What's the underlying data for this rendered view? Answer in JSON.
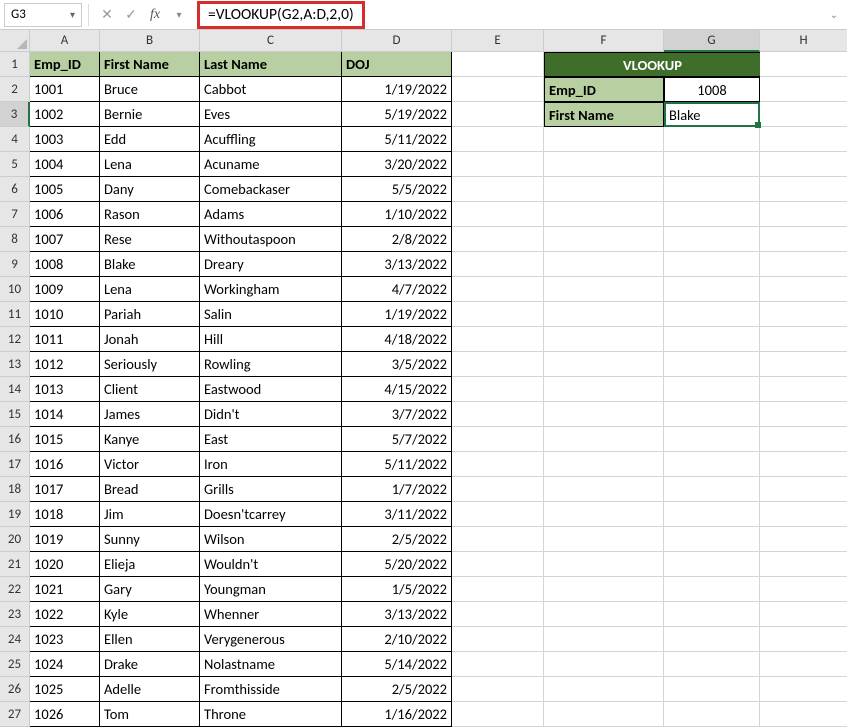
{
  "namebox": {
    "ref": "G3"
  },
  "formula": "=VLOOKUP(G2,A:D,2,0)",
  "columns": [
    "A",
    "B",
    "C",
    "D",
    "E",
    "F",
    "G",
    "H"
  ],
  "headers": {
    "a": "Emp_ID",
    "b": "First Name",
    "c": "Last Name",
    "d": "DOJ"
  },
  "vlookup": {
    "title": "VLOOKUP",
    "id_label": "Emp_ID",
    "id_value": "1008",
    "name_label": "First Name",
    "name_value": "Blake"
  },
  "rows": [
    {
      "id": "1001",
      "fn": "Bruce",
      "ln": "Cabbot",
      "doj": "1/19/2022"
    },
    {
      "id": "1002",
      "fn": "Bernie",
      "ln": "Eves",
      "doj": "5/19/2022"
    },
    {
      "id": "1003",
      "fn": "Edd",
      "ln": "Acuffling",
      "doj": "5/11/2022"
    },
    {
      "id": "1004",
      "fn": "Lena",
      "ln": "Acuname",
      "doj": "3/20/2022"
    },
    {
      "id": "1005",
      "fn": "Dany",
      "ln": "Comebackaser",
      "doj": "5/5/2022"
    },
    {
      "id": "1006",
      "fn": "Rason",
      "ln": "Adams",
      "doj": "1/10/2022"
    },
    {
      "id": "1007",
      "fn": "Rese",
      "ln": "Withoutaspoon",
      "doj": "2/8/2022"
    },
    {
      "id": "1008",
      "fn": "Blake",
      "ln": "Dreary",
      "doj": "3/13/2022"
    },
    {
      "id": "1009",
      "fn": "Lena",
      "ln": "Workingham",
      "doj": "4/7/2022"
    },
    {
      "id": "1010",
      "fn": "Pariah",
      "ln": "Salin",
      "doj": "1/19/2022"
    },
    {
      "id": "1011",
      "fn": "Jonah",
      "ln": "Hill",
      "doj": "4/18/2022"
    },
    {
      "id": "1012",
      "fn": "Seriously",
      "ln": "Rowling",
      "doj": "3/5/2022"
    },
    {
      "id": "1013",
      "fn": "Client",
      "ln": "Eastwood",
      "doj": "4/15/2022"
    },
    {
      "id": "1014",
      "fn": "James",
      "ln": "Didn't",
      "doj": "3/7/2022"
    },
    {
      "id": "1015",
      "fn": "Kanye",
      "ln": "East",
      "doj": "5/7/2022"
    },
    {
      "id": "1016",
      "fn": "Victor",
      "ln": "Iron",
      "doj": "5/11/2022"
    },
    {
      "id": "1017",
      "fn": "Bread",
      "ln": "Grills",
      "doj": "1/7/2022"
    },
    {
      "id": "1018",
      "fn": "Jim",
      "ln": "Doesn'tcarrey",
      "doj": "3/11/2022"
    },
    {
      "id": "1019",
      "fn": "Sunny",
      "ln": "Wilson",
      "doj": "2/5/2022"
    },
    {
      "id": "1020",
      "fn": "Elieja",
      "ln": "Wouldn't",
      "doj": "5/20/2022"
    },
    {
      "id": "1021",
      "fn": "Gary",
      "ln": "Youngman",
      "doj": "1/5/2022"
    },
    {
      "id": "1022",
      "fn": "Kyle",
      "ln": "Whenner",
      "doj": "3/13/2022"
    },
    {
      "id": "1023",
      "fn": "Ellen",
      "ln": "Verygenerous",
      "doj": "2/10/2022"
    },
    {
      "id": "1024",
      "fn": "Drake",
      "ln": "Nolastname",
      "doj": "5/14/2022"
    },
    {
      "id": "1025",
      "fn": "Adelle",
      "ln": "Fromthisside",
      "doj": "2/5/2022"
    },
    {
      "id": "1026",
      "fn": "Tom",
      "ln": "Throne",
      "doj": "1/16/2022"
    }
  ]
}
